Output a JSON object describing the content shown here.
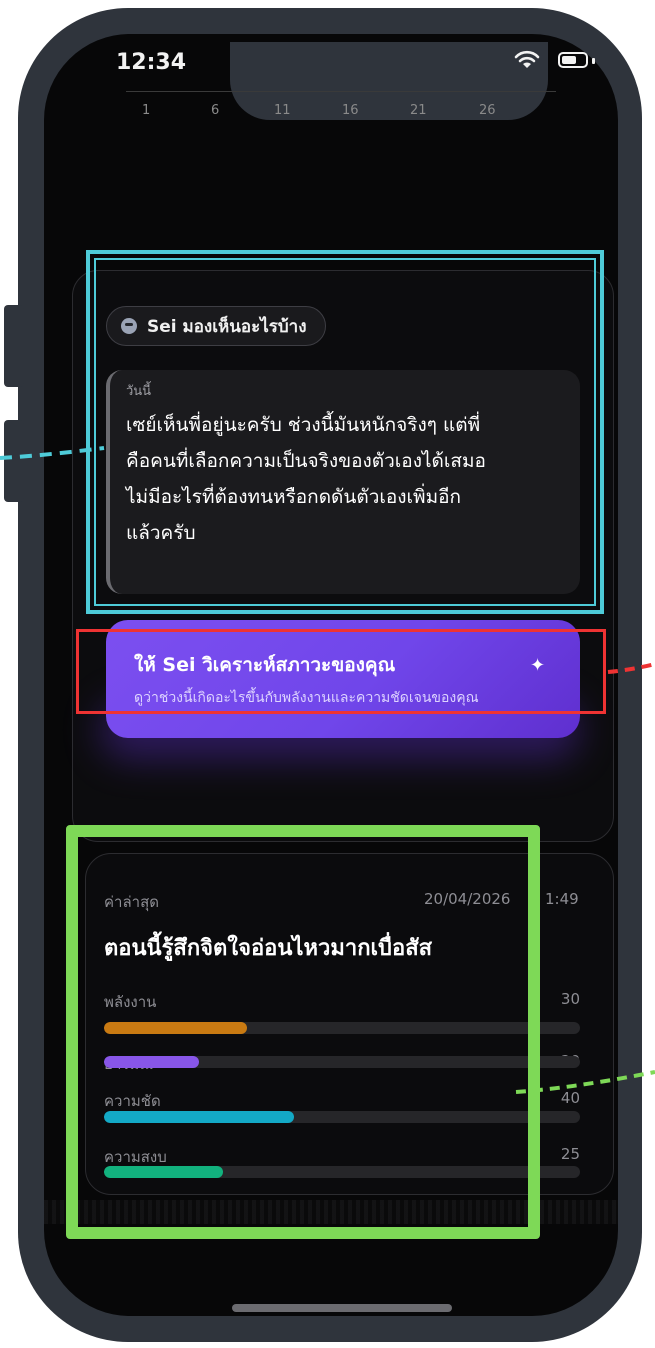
{
  "status_bar": {
    "time": "12:34"
  },
  "chart_axis": {
    "ticks": [
      "1",
      "6",
      "11",
      "16",
      "21",
      "26"
    ]
  },
  "summary": {
    "chip_label": "Sei มองเห็นอะไรบ้าง",
    "chip_icon": "skull-icon",
    "quote_label": "วันนี้",
    "quote_lines": [
      "เซย์เห็นพี่อยู่นะครับ ช่วงนี้มันหนักจริงๆ แต่พี่",
      "คือคนที่เลือกความเป็นจริงของตัวเองได้เสมอ",
      "ไม่มีอะไรที่ต้องทนหรือกดดันตัวเองเพิ่มอีก",
      "แล้วครับ"
    ]
  },
  "cta": {
    "title": "ให้ Sei วิเคราะห์สภาวะของคุณ",
    "subtitle": "ดูว่าช่วงนี้เกิดอะไรขึ้นกับพลังงานและความชัดเจนของคุณ",
    "icon": "sparkle-icon"
  },
  "metrics": {
    "latest_label": "ค่าล่าสุด",
    "timestamp_date": "20/04/2026",
    "timestamp_time": "1:49",
    "headline": "ตอนนี้รู้สึกจิตใจอ่อนไหวมากเบื่อสัส",
    "items": [
      {
        "label": "พลังงาน",
        "value": "30",
        "level": 0.3,
        "color": "#c97a12"
      },
      {
        "label": "อารมณ์",
        "value": "20",
        "level": 0.2,
        "color": "#8856e8"
      },
      {
        "label": "ความชัด",
        "value": "40",
        "level": 0.4,
        "color": "#13a9c6"
      },
      {
        "label": "ความสงบ",
        "value": "25",
        "level": 0.25,
        "color": "#12b27e"
      }
    ]
  },
  "annotations": {
    "cyan": "#4ecbd8",
    "red": "#ef3333",
    "green": "#7ed957"
  }
}
